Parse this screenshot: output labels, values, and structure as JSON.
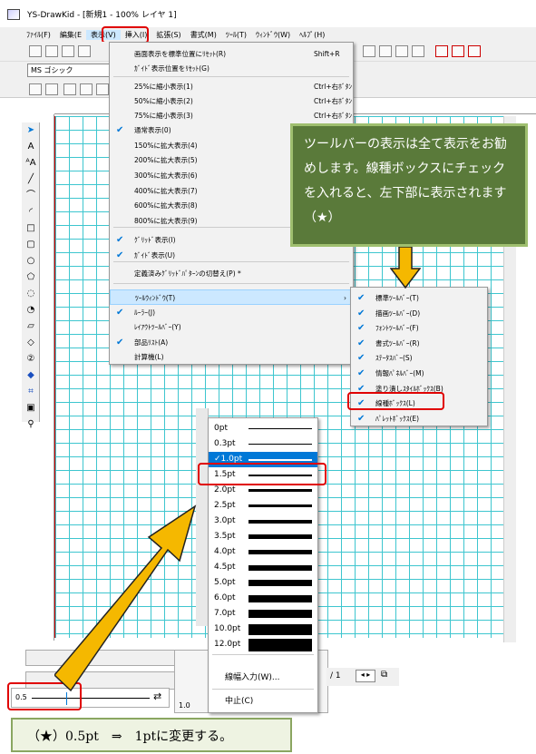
{
  "window": {
    "title": "YS-DrawKid - [新規1 - 100% レイヤ 1]"
  },
  "menubar": {
    "items": [
      "ﾌｧｲﾙ(F)",
      "編集(E",
      "表示(V)",
      "挿入(I)",
      "拡張(S)",
      "書式(M)",
      "ﾂｰﾙ(T)",
      "ｳｨﾝﾄﾞｳ(W)",
      "ﾍﾙﾌﾟ(H)"
    ]
  },
  "toolbar": {
    "font_name": "MS ゴシック"
  },
  "view_menu": {
    "items": [
      {
        "label": "画面表示を標準位置にﾘｾｯﾄ(R)",
        "shortcut": "Shift+R",
        "checked": false
      },
      {
        "label": "ｶﾞｲﾄﾞ表示位置をﾘｾｯﾄ(G)",
        "shortcut": "",
        "checked": false
      },
      {
        "label": "25%に縮小表示(1)",
        "shortcut": "Ctrl+右ﾎﾞﾀﾝ",
        "checked": false
      },
      {
        "label": "50%に縮小表示(2)",
        "shortcut": "Ctrl+右ﾎﾞﾀﾝ",
        "checked": false
      },
      {
        "label": "75%に縮小表示(3)",
        "shortcut": "Ctrl+右ﾎﾞﾀﾝ",
        "checked": false
      },
      {
        "label": "通常表示(0)",
        "shortcut": "Ctr",
        "checked": true
      },
      {
        "label": "150%に拡大表示(4)",
        "shortcut": "",
        "checked": false
      },
      {
        "label": "200%に拡大表示(5)",
        "shortcut": "",
        "checked": false
      },
      {
        "label": "300%に拡大表示(6)",
        "shortcut": "",
        "checked": false
      },
      {
        "label": "400%に拡大表示(7)",
        "shortcut": "",
        "checked": false
      },
      {
        "label": "600%に拡大表示(8)",
        "shortcut": "",
        "checked": false
      },
      {
        "label": "800%に拡大表示(9)",
        "shortcut": "",
        "checked": false
      },
      {
        "label": "ｸﾞﾘｯﾄﾞ表示(I)",
        "shortcut": "",
        "checked": true
      },
      {
        "label": "ｶﾞｲﾄﾞ表示(U)",
        "shortcut": "",
        "checked": true
      },
      {
        "label": "定義済みｸﾞﾘｯﾄﾞﾊﾟﾀｰﾝの切替え(P) *",
        "shortcut": "",
        "checked": false
      },
      {
        "label": "ﾂｰﾙｳｨﾝﾄﾞｳ(T)",
        "shortcut": "",
        "checked": false,
        "submenu": true
      },
      {
        "label": "ﾙｰﾗｰ(J)",
        "shortcut": "",
        "checked": true
      },
      {
        "label": "ﾚｲｱｳﾄﾂｰﾙﾊﾞｰ(Y)",
        "shortcut": "",
        "checked": false
      },
      {
        "label": "部品ﾘｽﾄ(A)",
        "shortcut": "",
        "checked": true
      },
      {
        "label": "計算機(L)",
        "shortcut": "",
        "checked": false
      }
    ]
  },
  "toolwindow_submenu": {
    "items": [
      {
        "label": "標準ﾂｰﾙﾊﾞｰ(T)",
        "checked": true
      },
      {
        "label": "描画ﾂｰﾙﾊﾞｰ(D)",
        "checked": true
      },
      {
        "label": "ﾌｫﾝﾄﾂｰﾙﾊﾞｰ(F)",
        "checked": true
      },
      {
        "label": "書式ﾂｰﾙﾊﾞｰ(R)",
        "checked": true
      },
      {
        "label": "ｽﾃｰﾀｽﾊﾞｰ(S)",
        "checked": true
      },
      {
        "label": "情報ﾊﾟﾈﾙﾊﾞｰ(M)",
        "checked": true
      },
      {
        "label": "塗り潰しｽﾀｲﾙﾎﾞｯｸｽ(B)",
        "checked": true
      },
      {
        "label": "線種ﾎﾞｯｸｽ(L)",
        "checked": true
      },
      {
        "label": "ﾊﾟﾚｯﾄﾎﾞｯｸｽ(E)",
        "checked": true
      }
    ]
  },
  "callout_top": {
    "text": "ツールバーの表示は全て表示をお勧めします。線種ボックスにチェックを入れると、左下部に表示されます（★）"
  },
  "linewidth_popup": {
    "items": [
      {
        "label": "0pt",
        "weight": 0.5
      },
      {
        "label": "0.3pt",
        "weight": 1
      },
      {
        "label": "✓1.0pt",
        "weight": 2,
        "selected": true
      },
      {
        "label": "1.5pt",
        "weight": 2
      },
      {
        "label": "2.0pt",
        "weight": 3
      },
      {
        "label": "2.5pt",
        "weight": 3
      },
      {
        "label": "3.0pt",
        "weight": 4
      },
      {
        "label": "3.5pt",
        "weight": 5
      },
      {
        "label": "4.0pt",
        "weight": 5
      },
      {
        "label": "4.5pt",
        "weight": 6
      },
      {
        "label": "5.0pt",
        "weight": 7
      },
      {
        "label": "6.0pt",
        "weight": 8
      },
      {
        "label": "7.0pt",
        "weight": 9
      },
      {
        "label": "10.0pt",
        "weight": 12
      },
      {
        "label": "12.0pt",
        "weight": 14
      }
    ],
    "custom_label": "線幅入力(W)...",
    "cancel_label": "中止(C)"
  },
  "linebox": {
    "value": "0.5",
    "value2": "1.0"
  },
  "statusbar": {
    "page_text": "/ 1"
  },
  "callout_bottom": {
    "text": "（★）0.5pt　⇒　1ptに変更する。"
  },
  "colors": {
    "accent": "#0078d7",
    "highlight": "#cce8ff",
    "red_box": "#e00000",
    "callout_bg": "#5a7a3a",
    "callout_border": "#9fbf6f",
    "arrow": "#f5b800",
    "grid": "#3ec6cf"
  }
}
